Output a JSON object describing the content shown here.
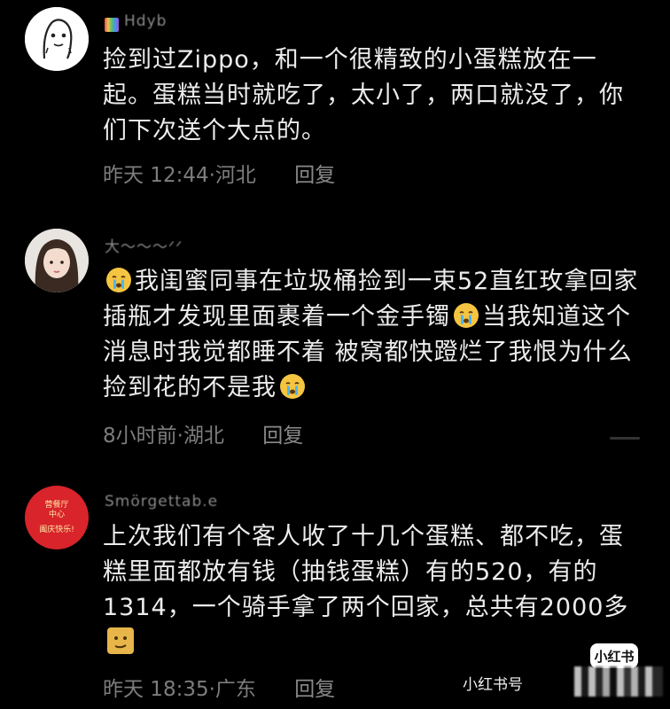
{
  "comments": [
    {
      "username": "Hdyb",
      "text": "捡到过Zippo，和一个很精致的小蛋糕放在一起。蛋糕当时就吃了，太小了，两口就没了，你们下次送个大点的。",
      "time": "昨天 12:44",
      "location": "河北",
      "reply_label": "回复"
    },
    {
      "username": "大～～～ᐟᐟ",
      "text_parts": [
        "我闺蜜同事在垃圾桶捡到一束52直红玫拿回家插瓶才发现里面裹着一个金手镯",
        "当我知道这个消息时我觉都睡不着 被窝都快蹬烂了我恨为什么捡到花的不是我"
      ],
      "time": "8小时前",
      "location": "湖北",
      "reply_label": "回复"
    },
    {
      "username": "Smörgettab.e",
      "avatar_text": [
        "营餐厅",
        "中心",
        "阖庆快乐!"
      ],
      "text": "上次我们有个客人收了十几个蛋糕、都不吃，蛋糕里面都放有钱（抽钱蛋糕）有的520，有的1314，一个骑手拿了两个回家，总共有2000多",
      "time": "昨天 18:35",
      "location": "广东",
      "reply_label": "回复"
    }
  ],
  "watermark": {
    "badge": "小红书",
    "text": "小红书号"
  },
  "colors": {
    "background": "#000000",
    "text": "#ececec",
    "meta": "#7d7d7d"
  }
}
